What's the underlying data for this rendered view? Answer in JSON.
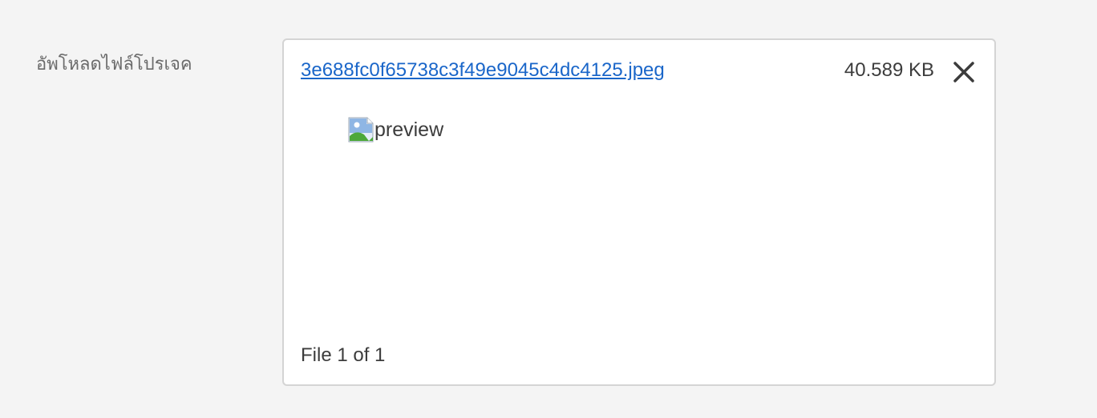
{
  "field": {
    "label": "อัพโหลดไฟล์โปรเจค"
  },
  "upload": {
    "file_name": "3e688fc0f65738c3f49e9045c4dc4125.jpeg",
    "file_size": "40.589 KB",
    "remove_icon": "close-icon",
    "preview_alt": "preview",
    "preview_icon": "broken-image-icon",
    "counter": "File 1 of 1"
  },
  "colors": {
    "background": "#f4f4f4",
    "panel": "#ffffff",
    "panel_border": "#d4d4d4",
    "link": "#1a66c9",
    "text": "#3c3c3c",
    "label": "#6b6b6b"
  }
}
